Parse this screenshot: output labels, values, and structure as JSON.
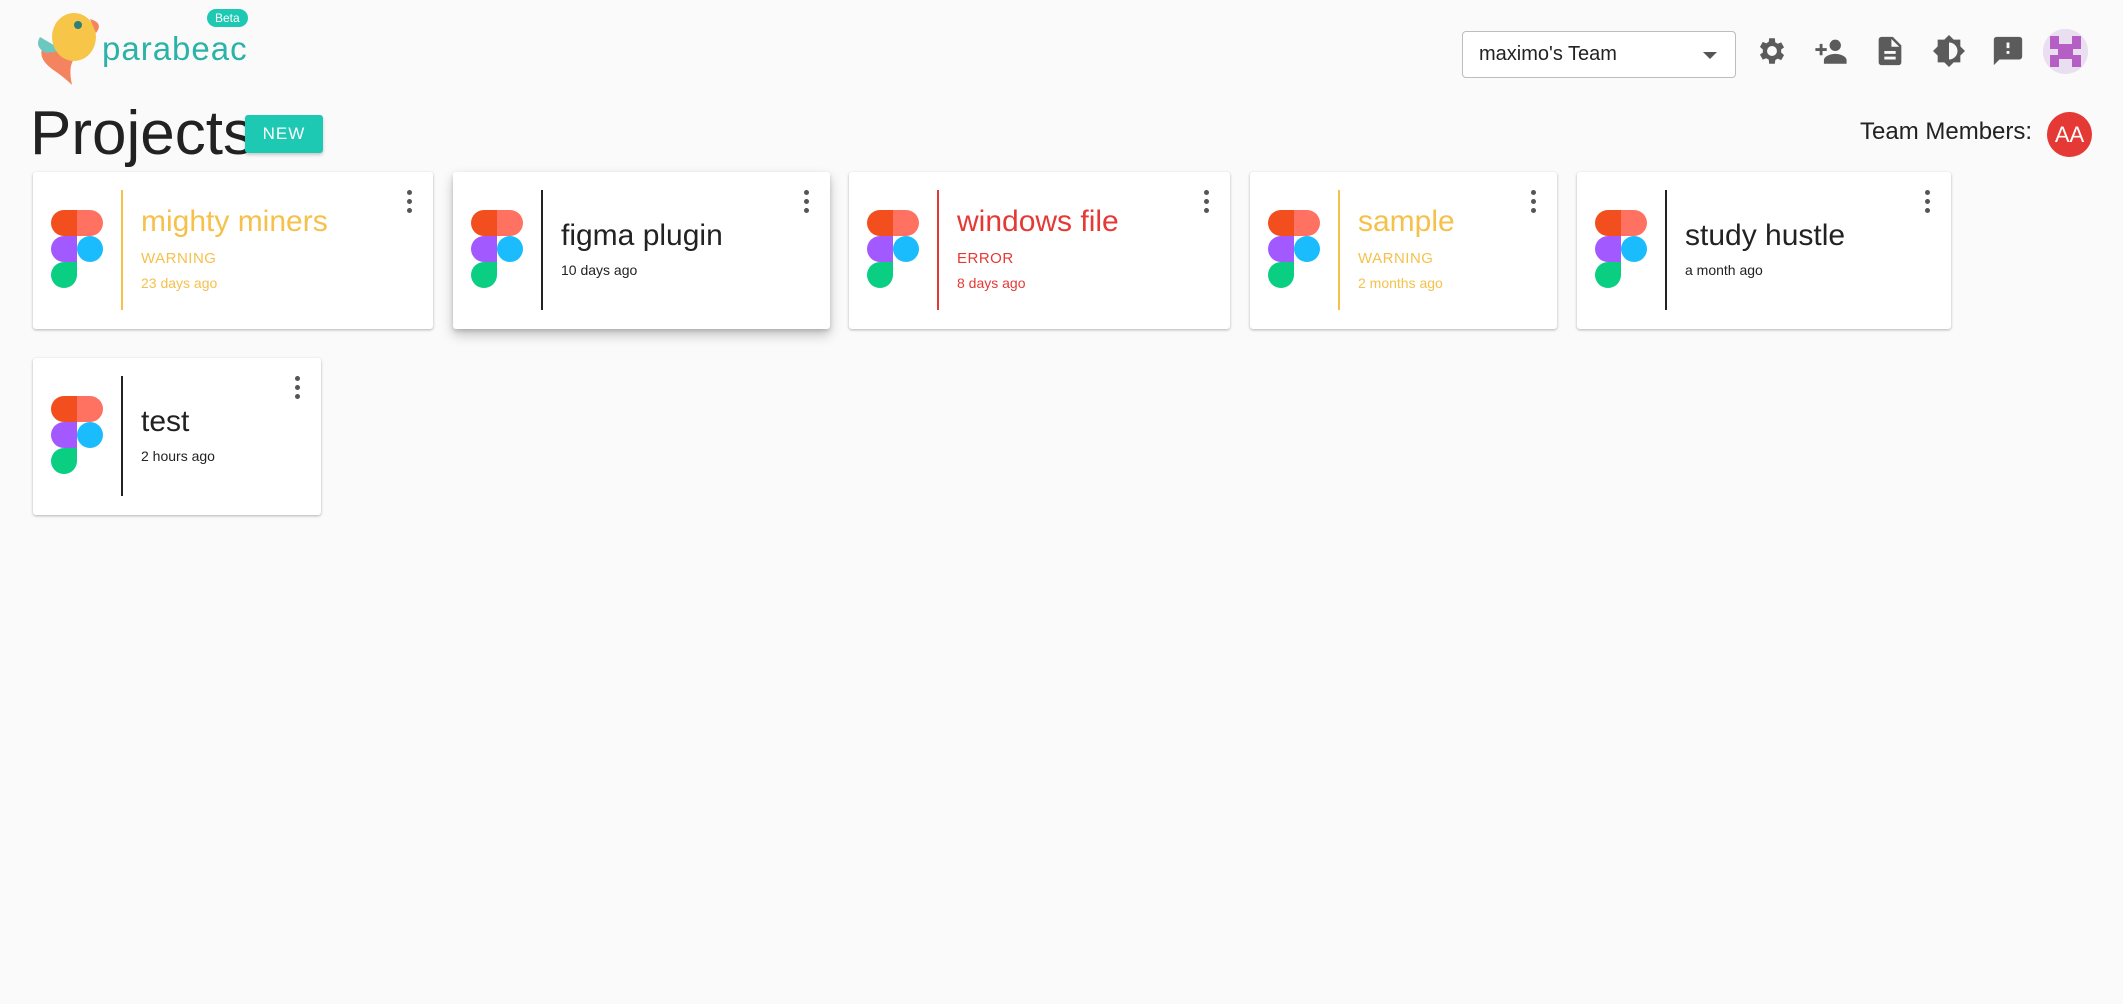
{
  "header": {
    "logo_text": "parabeac",
    "beta_label": "Beta",
    "team_select": "maximo's Team",
    "icons": [
      "gear-icon",
      "person-add-icon",
      "document-icon",
      "brightness-icon",
      "feedback-icon"
    ]
  },
  "page": {
    "title": "Projects",
    "new_button": "NEW",
    "members_label": "Team Members:",
    "member_initials": "AA"
  },
  "colors": {
    "accent": "#1ec9b3",
    "warning": "#f5c14b",
    "error": "#e53935",
    "normal": "#222222"
  },
  "projects": [
    {
      "name": "mighty miners",
      "status": "WARNING",
      "time": "23 days ago",
      "state": "warning"
    },
    {
      "name": "figma plugin",
      "status": "",
      "time": "10 days ago",
      "state": "normal"
    },
    {
      "name": "windows file",
      "status": "ERROR",
      "time": "8 days ago",
      "state": "error"
    },
    {
      "name": "sample",
      "status": "WARNING",
      "time": "2 months ago",
      "state": "warning"
    },
    {
      "name": "study hustle",
      "status": "",
      "time": "a month ago",
      "state": "normal"
    },
    {
      "name": "test",
      "status": "",
      "time": "2 hours ago",
      "state": "normal"
    }
  ]
}
